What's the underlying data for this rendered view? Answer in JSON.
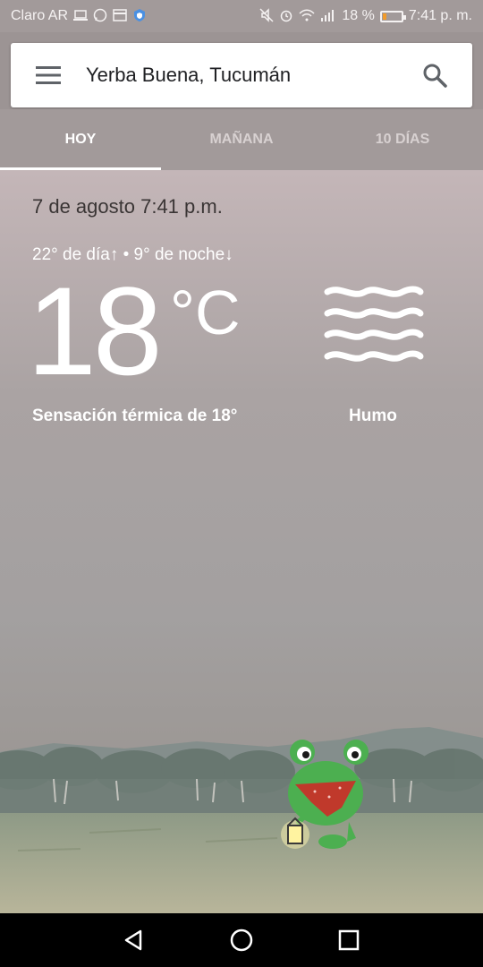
{
  "status_bar": {
    "carrier": "Claro AR",
    "battery_percent_text": "18 %",
    "battery_level": 0.18,
    "time": "7:41 p. m.",
    "icons_left": [
      "laptop-icon",
      "whatsapp-icon",
      "card-icon",
      "shield-icon"
    ],
    "icons_right": [
      "mute-icon",
      "alarm-icon",
      "wifi-icon",
      "signal-icon",
      "battery-icon"
    ]
  },
  "search": {
    "location": "Yerba Buena, Tucumán",
    "menu_icon": "hamburger-menu-icon",
    "search_icon": "search-icon"
  },
  "tabs": [
    {
      "label": "HOY",
      "active": true
    },
    {
      "label": "MAÑANA",
      "active": false
    },
    {
      "label": "10 DÍAS",
      "active": false
    }
  ],
  "weather": {
    "datetime": "7 de agosto 7:41 p.m.",
    "day_night": "22° de día↑ • 9° de noche↓",
    "temperature": "18",
    "unit": "°C",
    "feels_like": "Sensación térmica de 18°",
    "condition": "Humo",
    "condition_icon": "smoke-waves-icon"
  },
  "colors": {
    "accent": "#ffffff",
    "battery_fill": "#f29b2a",
    "frog": "#4caf50",
    "bandana": "#c0392b"
  },
  "nav_bar": {
    "icons": [
      "back-icon",
      "home-icon",
      "recents-icon"
    ]
  }
}
